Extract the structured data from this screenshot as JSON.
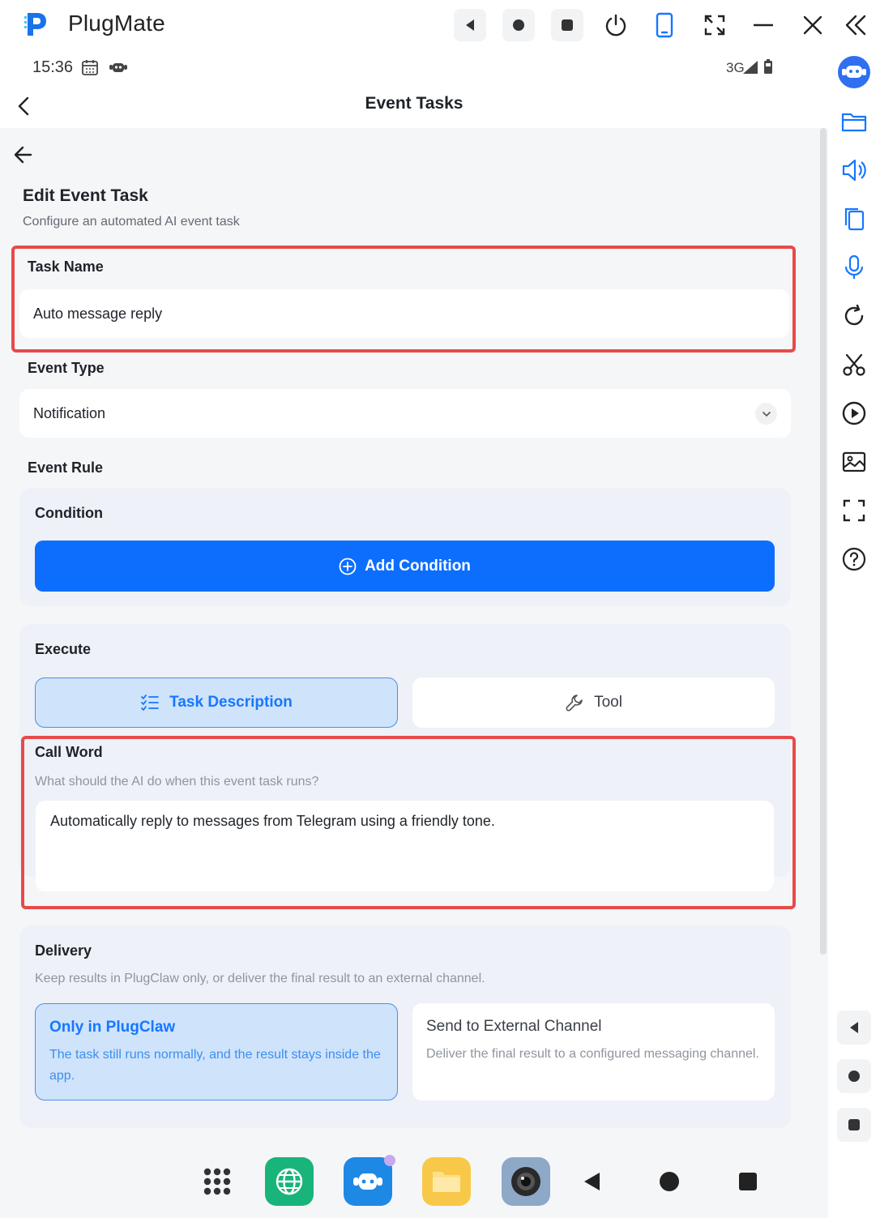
{
  "window": {
    "app_name": "PlugMate"
  },
  "status_bar": {
    "time": "15:36",
    "network": "3G"
  },
  "app_bar": {
    "title": "Event Tasks"
  },
  "form": {
    "title": "Edit Event Task",
    "subtitle": "Configure an automated AI event task",
    "task_name": {
      "label": "Task Name",
      "value": "Auto message reply"
    },
    "event_type": {
      "label": "Event Type",
      "value": "Notification"
    },
    "event_rule": {
      "label": "Event Rule",
      "condition_title": "Condition",
      "add_condition_label": "Add Condition"
    },
    "execute": {
      "title": "Execute",
      "tabs": [
        {
          "label": "Task Description",
          "selected": true
        },
        {
          "label": "Tool",
          "selected": false
        }
      ]
    },
    "call_word": {
      "label": "Call Word",
      "hint": "What should the AI do when this event task runs?",
      "value": "Automatically reply to messages from Telegram using a friendly tone."
    },
    "delivery": {
      "title": "Delivery",
      "hint": "Keep results in PlugClaw only, or deliver the final result to an external channel.",
      "options": [
        {
          "title": "Only in PlugClaw",
          "description": "The task still runs normally, and the result stays inside the app.",
          "selected": true
        },
        {
          "title": "Send to External Channel",
          "description": "Deliver the final result to a configured messaging channel.",
          "selected": false
        }
      ]
    }
  },
  "colors": {
    "accent": "#0d6efd",
    "highlight_border": "#e84a4a",
    "selected_bg": "#cfe3fb"
  }
}
